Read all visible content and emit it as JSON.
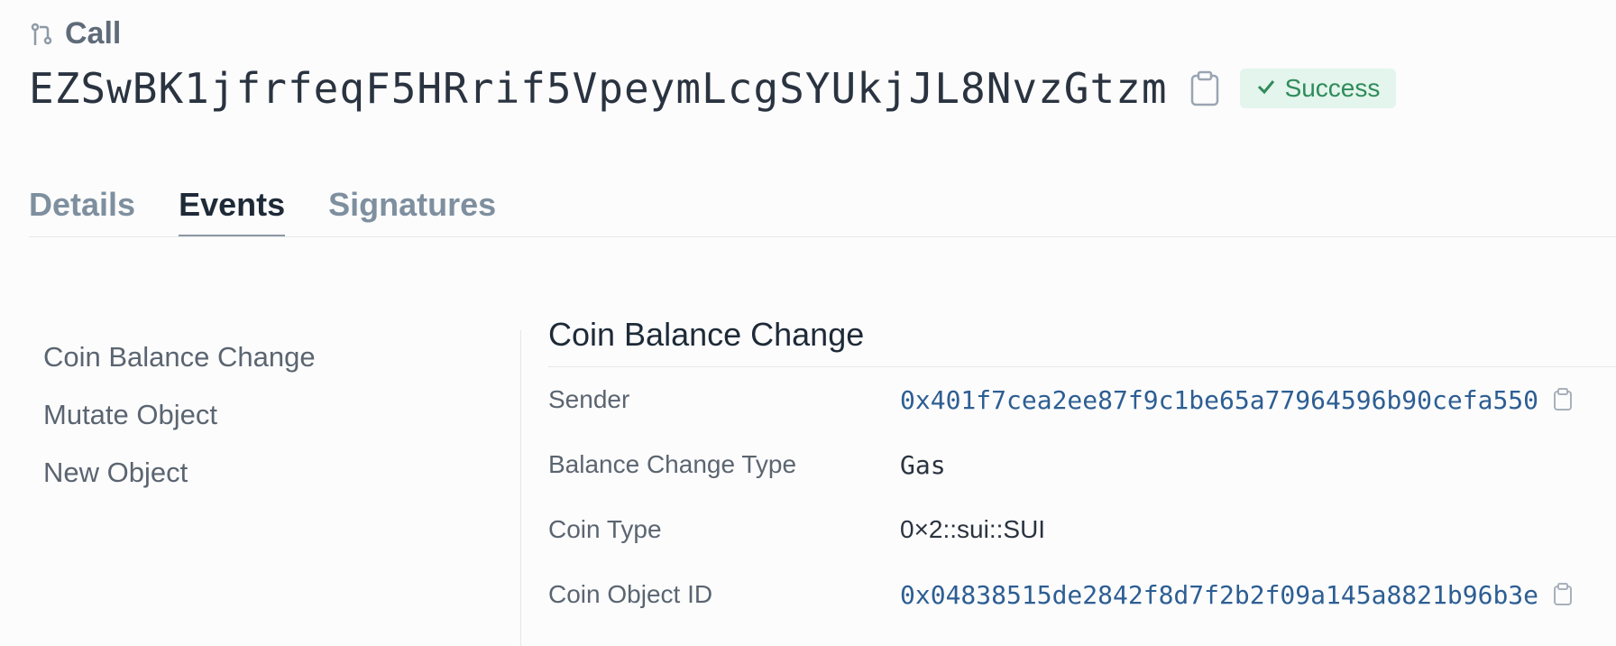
{
  "header": {
    "type_label": "Call",
    "tx_id": "EZSwBK1jfrfeqF5HRrif5VpeymLcgSYUkjJL8NvzGtzm",
    "status": "Success",
    "status_color": "#2f8b5a",
    "status_bg": "#e3f5ec",
    "icons": {
      "type": "transaction-call-icon",
      "copy": "clipboard-icon",
      "status": "checkmark-icon"
    }
  },
  "tabs": [
    {
      "label": "Details",
      "active": false
    },
    {
      "label": "Events",
      "active": true
    },
    {
      "label": "Signatures",
      "active": false
    }
  ],
  "events_nav": [
    {
      "label": "Coin Balance Change"
    },
    {
      "label": "Mutate Object"
    },
    {
      "label": "New Object"
    }
  ],
  "event_detail": {
    "title": "Coin Balance Change",
    "rows": [
      {
        "label": "Sender",
        "value": "0x401f7cea2ee87f9c1be65a77964596b90cefa550",
        "copyable": true
      },
      {
        "label": "Balance Change Type",
        "value": "Gas",
        "copyable": false
      },
      {
        "label": "Coin Type",
        "value": "0×2::sui::SUI",
        "copyable": false
      },
      {
        "label": "Coin Object ID",
        "value": "0x04838515de2842f8d7f2b2f09a145a8821b96b3e",
        "copyable": true
      }
    ]
  },
  "colors": {
    "link": "#2d5e93",
    "accent_text": "#1e2a38",
    "muted_tab": "#7e8f9f"
  }
}
